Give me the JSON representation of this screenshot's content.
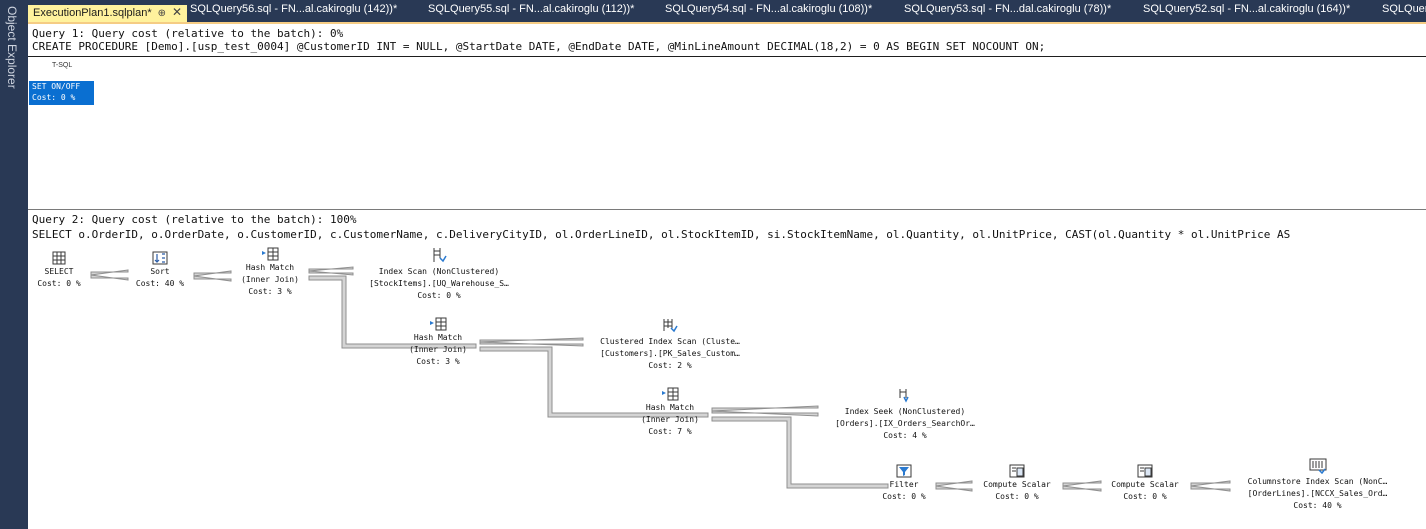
{
  "side": {
    "label": "Object Explorer"
  },
  "tabs": [
    {
      "label": "ExecutionPlan1.sqlplan*",
      "active": true
    },
    {
      "label": "SQLQuery56.sql - FN...al.cakiroglu (142))*"
    },
    {
      "label": "SQLQuery55.sql - FN...al.cakiroglu (112))*"
    },
    {
      "label": "SQLQuery54.sql - FN...al.cakiroglu (108))*"
    },
    {
      "label": "SQLQuery53.sql - FN...dal.cakiroglu (78))*"
    },
    {
      "label": "SQLQuery52.sql - FN...al.cakiroglu (164))*"
    },
    {
      "label": "SQLQuery"
    }
  ],
  "tab_pin": "⊕",
  "tab_close": "✕",
  "query1": {
    "header": "Query 1: Query cost (relative to the batch): 0%",
    "sql": "CREATE PROCEDURE [Demo].[usp_test_0004] @CustomerID INT = NULL, @StartDate DATE, @EndDate DATE, @MinLineAmount DECIMAL(18,2) = 0 AS BEGIN SET NOCOUNT ON;",
    "tsql_label": "T-SQL",
    "node": {
      "line1": "SET ON/OFF",
      "line2": "Cost: 0 %"
    }
  },
  "query2": {
    "header": "Query 2: Query cost (relative to the batch): 100%",
    "sql": "SELECT o.OrderID, o.OrderDate, o.CustomerID, c.CustomerName, c.DeliveryCityID, ol.OrderLineID, ol.StockItemID, si.StockItemName, ol.Quantity, ol.UnitPrice, CAST(ol.Quantity * ol.UnitPrice AS"
  },
  "nodes": {
    "select": {
      "l1": "SELECT",
      "l2": "Cost: 0 %",
      "icon": "select-icon"
    },
    "sort": {
      "l1": "Sort",
      "l2": "Cost: 40 %",
      "icon": "sort-icon"
    },
    "hash1": {
      "l1": "Hash Match",
      "l2": "(Inner Join)",
      "l3": "Cost: 3 %",
      "icon": "hash-match-icon"
    },
    "scan1": {
      "l1": "Index Scan (NonClustered)",
      "l2": "[StockItems].[UQ_Warehouse_S…",
      "l3": "Cost: 0 %",
      "icon": "index-scan-icon"
    },
    "hash2": {
      "l1": "Hash Match",
      "l2": "(Inner Join)",
      "l3": "Cost: 3 %",
      "icon": "hash-match-icon"
    },
    "scan2": {
      "l1": "Clustered Index Scan (Cluste…",
      "l2": "[Customers].[PK_Sales_Custom…",
      "l3": "Cost: 2 %",
      "icon": "clustered-index-scan-icon"
    },
    "hash3": {
      "l1": "Hash Match",
      "l2": "(Inner Join)",
      "l3": "Cost: 7 %",
      "icon": "hash-match-icon"
    },
    "seek": {
      "l1": "Index Seek (NonClustered)",
      "l2": "[Orders].[IX_Orders_SearchOr…",
      "l3": "Cost: 4 %",
      "icon": "index-seek-icon"
    },
    "filter": {
      "l1": "Filter",
      "l2": "Cost: 0 %",
      "icon": "filter-icon"
    },
    "cs1": {
      "l1": "Compute Scalar",
      "l2": "Cost: 0 %",
      "icon": "compute-scalar-icon"
    },
    "cs2": {
      "l1": "Compute Scalar",
      "l2": "Cost: 0 %",
      "icon": "compute-scalar-icon"
    },
    "colscan": {
      "l1": "Columnstore Index Scan (NonC…",
      "l2": "[OrderLines].[NCCX_Sales_Ord…",
      "l3": "Cost: 40 %",
      "icon": "columnstore-index-scan-icon"
    }
  }
}
